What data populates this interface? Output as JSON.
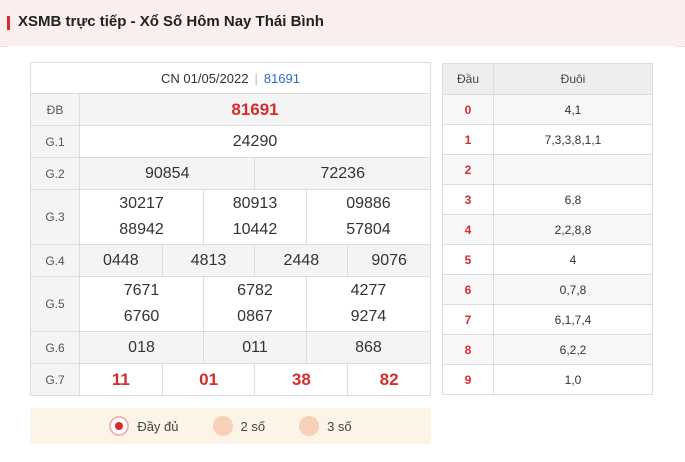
{
  "header": {
    "title": "XSMB trực tiếp - Xổ Số Hôm Nay Thái Bình"
  },
  "results": {
    "date": "CN 01/05/2022",
    "code": "81691",
    "db_label": "ĐB",
    "db": "81691",
    "g1_label": "G.1",
    "g1": "24290",
    "g2_label": "G.2",
    "g2": [
      "90854",
      "72236"
    ],
    "g3_label": "G.3",
    "g3": [
      "30217",
      "80913",
      "09886",
      "88942",
      "10442",
      "57804"
    ],
    "g4_label": "G.4",
    "g4": [
      "0448",
      "4813",
      "2448",
      "9076"
    ],
    "g5_label": "G.5",
    "g5": [
      "7671",
      "6782",
      "4277",
      "6760",
      "0867",
      "9274"
    ],
    "g6_label": "G.6",
    "g6": [
      "018",
      "011",
      "868"
    ],
    "g7_label": "G.7",
    "g7": [
      "11",
      "01",
      "38",
      "82"
    ]
  },
  "radio": [
    {
      "label": "Đầy đủ",
      "selected": true
    },
    {
      "label": "2 số",
      "selected": false
    },
    {
      "label": "3 số",
      "selected": false
    }
  ],
  "loto": {
    "head_label": "Đầu",
    "tail_label": "Đuôi",
    "rows": [
      {
        "dau": "0",
        "duoi": "4,1"
      },
      {
        "dau": "1",
        "duoi": "7,3,3,8,1,1"
      },
      {
        "dau": "2",
        "duoi": ""
      },
      {
        "dau": "3",
        "duoi": "6,8"
      },
      {
        "dau": "4",
        "duoi": "2,2,8,8"
      },
      {
        "dau": "5",
        "duoi": "4"
      },
      {
        "dau": "6",
        "duoi": "0,7,8"
      },
      {
        "dau": "7",
        "duoi": "6,1,7,4"
      },
      {
        "dau": "8",
        "duoi": "6,2,2"
      },
      {
        "dau": "9",
        "duoi": "1,0"
      }
    ]
  },
  "colors": {
    "accent": "#d52d2d",
    "link": "#2d6bd2",
    "header_bg": "#fbeeee"
  }
}
